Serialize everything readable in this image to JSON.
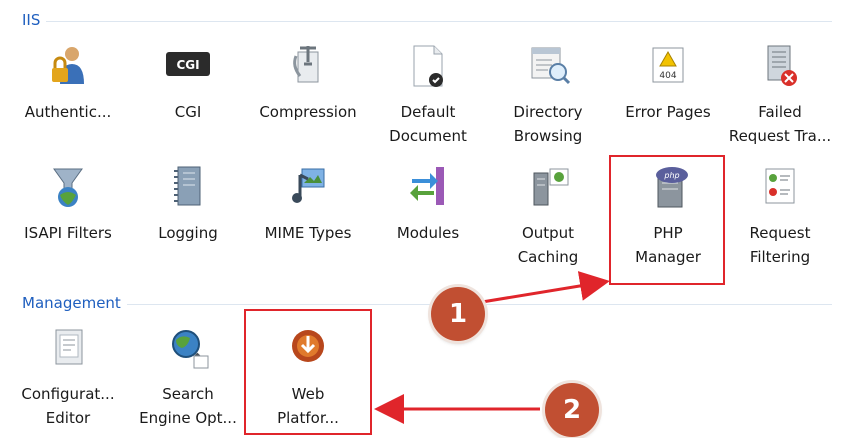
{
  "sections": {
    "iis": "IIS",
    "management": "Management"
  },
  "iis_row1": [
    {
      "label": "Authentic...",
      "icon": "authentication-icon"
    },
    {
      "label": "CGI",
      "icon": "cgi-icon"
    },
    {
      "label": "Compression",
      "icon": "compression-icon"
    },
    {
      "label": "Default\nDocument",
      "icon": "default-document-icon"
    },
    {
      "label": "Directory\nBrowsing",
      "icon": "directory-browsing-icon"
    },
    {
      "label": "Error Pages",
      "icon": "error-pages-icon"
    },
    {
      "label": "Failed\nRequest Tra...",
      "icon": "failed-request-tracing-icon"
    }
  ],
  "iis_row2": [
    {
      "label": "ISAPI Filters",
      "icon": "isapi-filters-icon"
    },
    {
      "label": "Logging",
      "icon": "logging-icon"
    },
    {
      "label": "MIME Types",
      "icon": "mime-types-icon"
    },
    {
      "label": "Modules",
      "icon": "modules-icon"
    },
    {
      "label": "Output\nCaching",
      "icon": "output-caching-icon"
    },
    {
      "label": "PHP\nManager",
      "icon": "php-manager-icon"
    },
    {
      "label": "Request\nFiltering",
      "icon": "request-filtering-icon"
    }
  ],
  "management_row": [
    {
      "label": "Configurat...\nEditor",
      "icon": "configuration-editor-icon"
    },
    {
      "label": "Search\nEngine Opt...",
      "icon": "search-engine-optimization-icon"
    },
    {
      "label": "Web\nPlatfor...",
      "icon": "web-platform-installer-icon"
    }
  ],
  "callouts": [
    "1",
    "2"
  ],
  "colors": {
    "section_title": "#1f5fbf",
    "highlight": "#e0252b",
    "badge": "#c14f32"
  }
}
